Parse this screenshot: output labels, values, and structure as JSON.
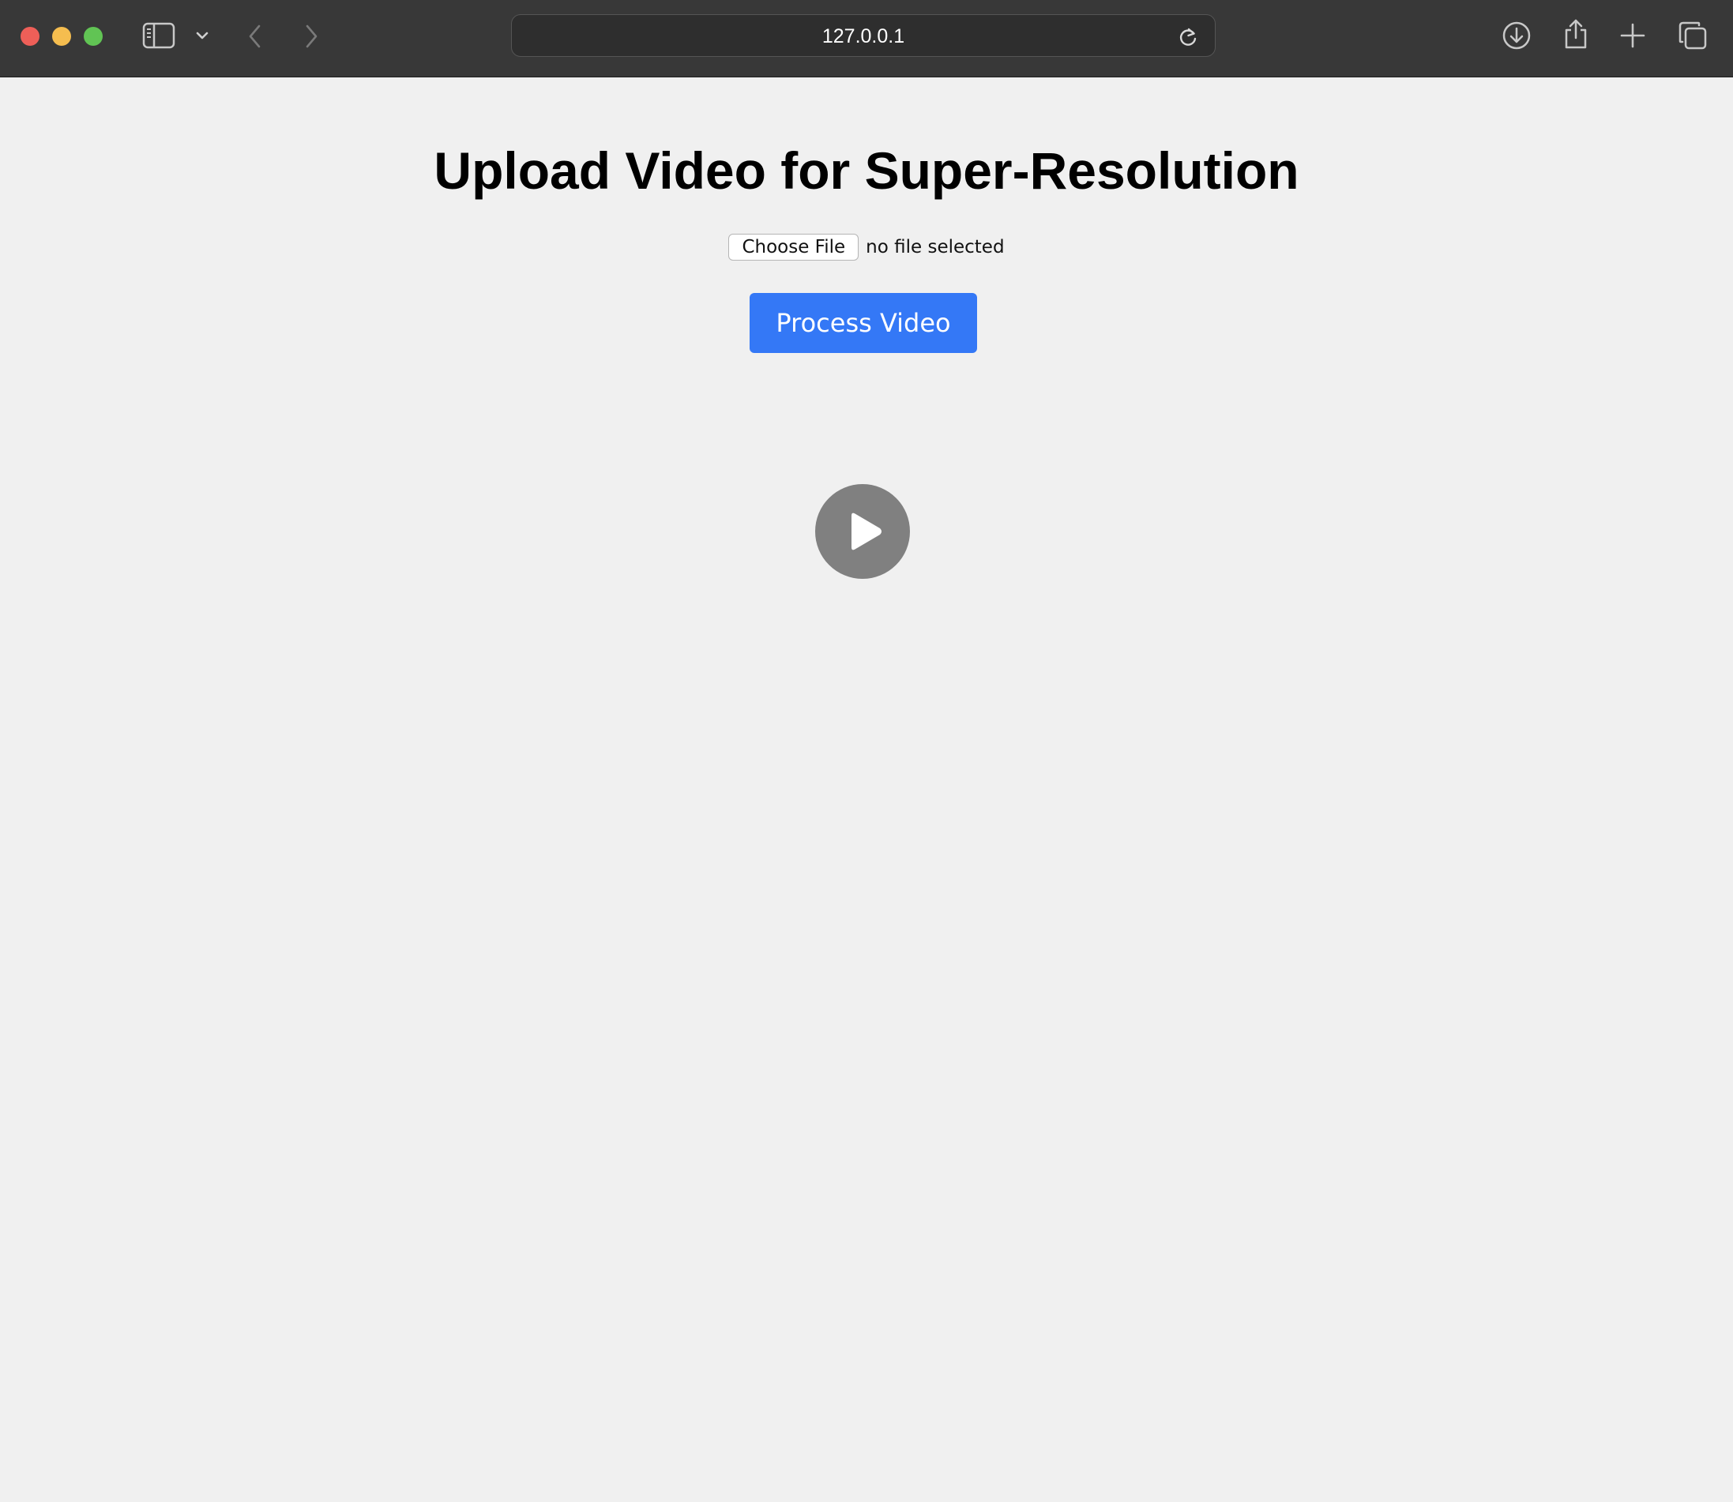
{
  "browser": {
    "url": "127.0.0.1",
    "colors": {
      "close": "#ee5f58",
      "minimize": "#f5bd4f",
      "maximize": "#61c454",
      "toolbar_bg": "#383838"
    },
    "icons": [
      "sidebar-icon",
      "chevron-down-icon",
      "back-icon",
      "forward-icon",
      "reload-icon",
      "download-icon",
      "share-icon",
      "new-tab-icon",
      "tabs-overview-icon"
    ]
  },
  "page": {
    "title": "Upload Video for Super-Resolution",
    "file_input": {
      "button_label": "Choose File",
      "status": "no file selected"
    },
    "process_button": "Process Video",
    "video_player": {
      "icon": "play-icon"
    },
    "colors": {
      "background": "#f0f0f0",
      "primary": "#3478f6",
      "play_circle": "#808080"
    }
  }
}
